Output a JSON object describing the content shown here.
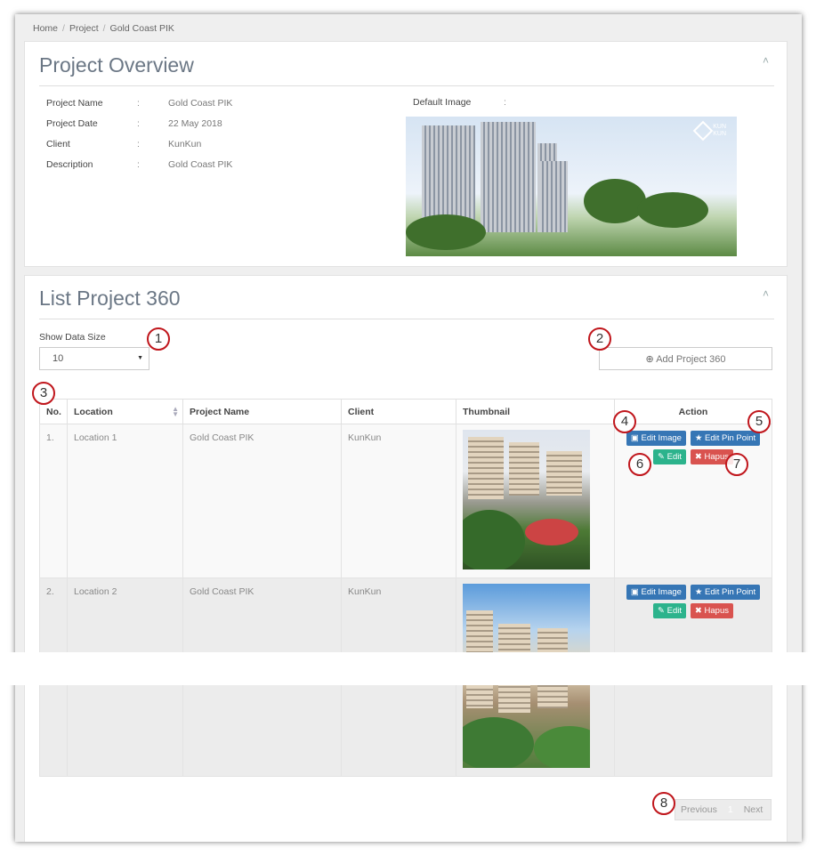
{
  "breadcrumb": [
    "Home",
    "Project",
    "Gold Coast PIK"
  ],
  "overview": {
    "title": "Project Overview",
    "collapse_icon": "chevron-up-icon",
    "fields": [
      {
        "label": "Project Name",
        "value": "Gold Coast PIK"
      },
      {
        "label": "Project Date",
        "value": "22 May 2018"
      },
      {
        "label": "Client",
        "value": "KunKun"
      },
      {
        "label": "Description",
        "value": "Gold Coast PIK"
      }
    ],
    "colon": ":",
    "default_image_label": "Default Image",
    "logo_text": [
      "KUN",
      "KUN"
    ]
  },
  "list": {
    "title": "List Project 360",
    "show_label": "Show Data Size",
    "page_size": "10",
    "add_button": "Add Project 360",
    "columns": [
      "No.",
      "Location",
      "Project Name",
      "Client",
      "Thumbnail",
      "Action"
    ],
    "rows": [
      {
        "no": "1.",
        "location": "Location 1",
        "project": "Gold Coast PIK",
        "client": "KunKun"
      },
      {
        "no": "2.",
        "location": "Location 2",
        "project": "Gold Coast PIK",
        "client": "KunKun"
      }
    ],
    "actions": {
      "edit_image": "Edit Image",
      "edit_pin": "Edit Pin Point",
      "edit": "Edit",
      "delete": "Hapus"
    }
  },
  "pagination": {
    "previous": "Previous",
    "current": "1",
    "next": "Next"
  },
  "markers": [
    "1",
    "2",
    "3",
    "4",
    "5",
    "6",
    "7",
    "8"
  ],
  "colors": {
    "blue": "#3676b5",
    "green": "#2cb38c",
    "red": "#d9534f",
    "marker": "#c0161c"
  }
}
